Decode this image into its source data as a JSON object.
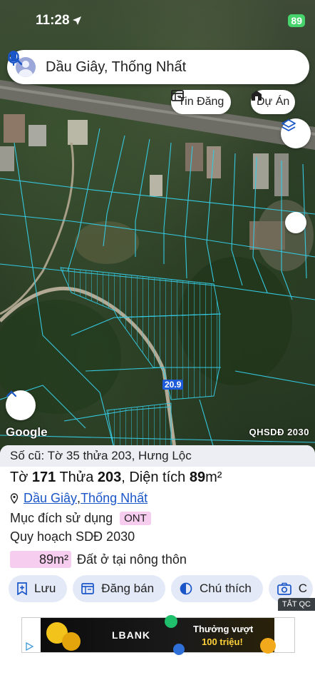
{
  "status": {
    "time": "11:28",
    "battery": "89"
  },
  "search": {
    "query": "Dầu Giây, Thống Nhất"
  },
  "chips": {
    "listings": "Tin Đăng",
    "projects": "Dự Án"
  },
  "map": {
    "parcel_area_label": "20.9",
    "watermark": "Google",
    "plan_label": "QHSDĐ 2030"
  },
  "sheet": {
    "old_info": "Số cũ: Tờ 35 thửa 203, Hưng Lộc",
    "sheet_prefix": "Tờ ",
    "sheet_no": "171",
    "plot_prefix": " Thửa ",
    "plot_no": "203",
    "area_prefix": ", Diện tích ",
    "area_value": "89",
    "area_unit": "m²",
    "district": "Dầu Giây",
    "separator": ", ",
    "province": "Thống Nhất",
    "purpose_label": "Mục đích sử dụng",
    "purpose_code": "ONT",
    "plan_label": "Quy hoạch SDĐ 2030",
    "plan_area": "89m²",
    "plan_desc": "Đất ở tại nông thôn"
  },
  "actions": {
    "save": "Lưu",
    "post": "Đăng bán",
    "legend": "Chú thích",
    "capture": "C"
  },
  "ad": {
    "close_label": "TẮT QC",
    "brand": "LBANK",
    "line1": "Thưởng vượt",
    "line2": "100 triệu!"
  },
  "colors": {
    "accent": "#1a56c8",
    "action_bg": "#e3e9f7",
    "ont_tag": "#f6cdee",
    "battery": "#47d36b"
  }
}
